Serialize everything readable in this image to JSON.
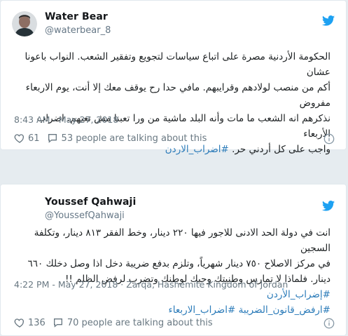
{
  "tweets": [
    {
      "name": "Water Bear",
      "handle": "@waterbear_8",
      "lines": [
        "الحكومة الأردنية مصرة على اتباع سياسات لتجويع وتفقير الشعب. النواب باعونا عشان",
        "أكم من منصب لولادهم وقرايبهم. مافي حدا رح يوقف معك إلا أنت، يوم الاربعاء مفروض",
        "نذكرهم انه الشعب ما مات وأنه البلد ماشية من ورا تعبنا مش تعبهم. اضراب الأربعاء",
        "واجب على كل أردني حر."
      ],
      "hashtag": "#اضراب_الاردن",
      "timestamp": "8:43 AM - May 27, 2018",
      "likes": "61",
      "talking": "53 people are talking about this"
    },
    {
      "name": "Youssef Qahwaji",
      "handle": "@YoussefQahwaji",
      "lines": [
        "انت في دولة الحد الادنى للاجور فيها ٢٢٠ دينار، وخط الفقر ٨١٣ دينار، وتكلفة السجين",
        "في مركز الاصلاح ٧٥٠ دينار شهرياً، وتلزم بدفع ضريبة دخل اذا وصل دخلك ٦٦٠",
        "دينار. فلماذا لا تمارس وطنيتك وحبك لوطنك وتضرب لرفض الظلم !!"
      ],
      "hashtag_inline": "#إضراب_الأردن",
      "hashtags_last": "#ارفض_قانون_الضريبة #اضراب_الاربعاء",
      "timestamp": "4:22 PM - May 27, 2018 · Zarqa, Hashemite Kingdom of Jordan",
      "likes": "136",
      "talking": "70 people are talking about this"
    }
  ],
  "icons": [
    "heart-icon",
    "comment-icon",
    "twitter-bird-icon",
    "info-icon"
  ],
  "colors": {
    "accent": "#1da1f2",
    "hashtag": "#2b7bb9",
    "muted": "#697882"
  }
}
